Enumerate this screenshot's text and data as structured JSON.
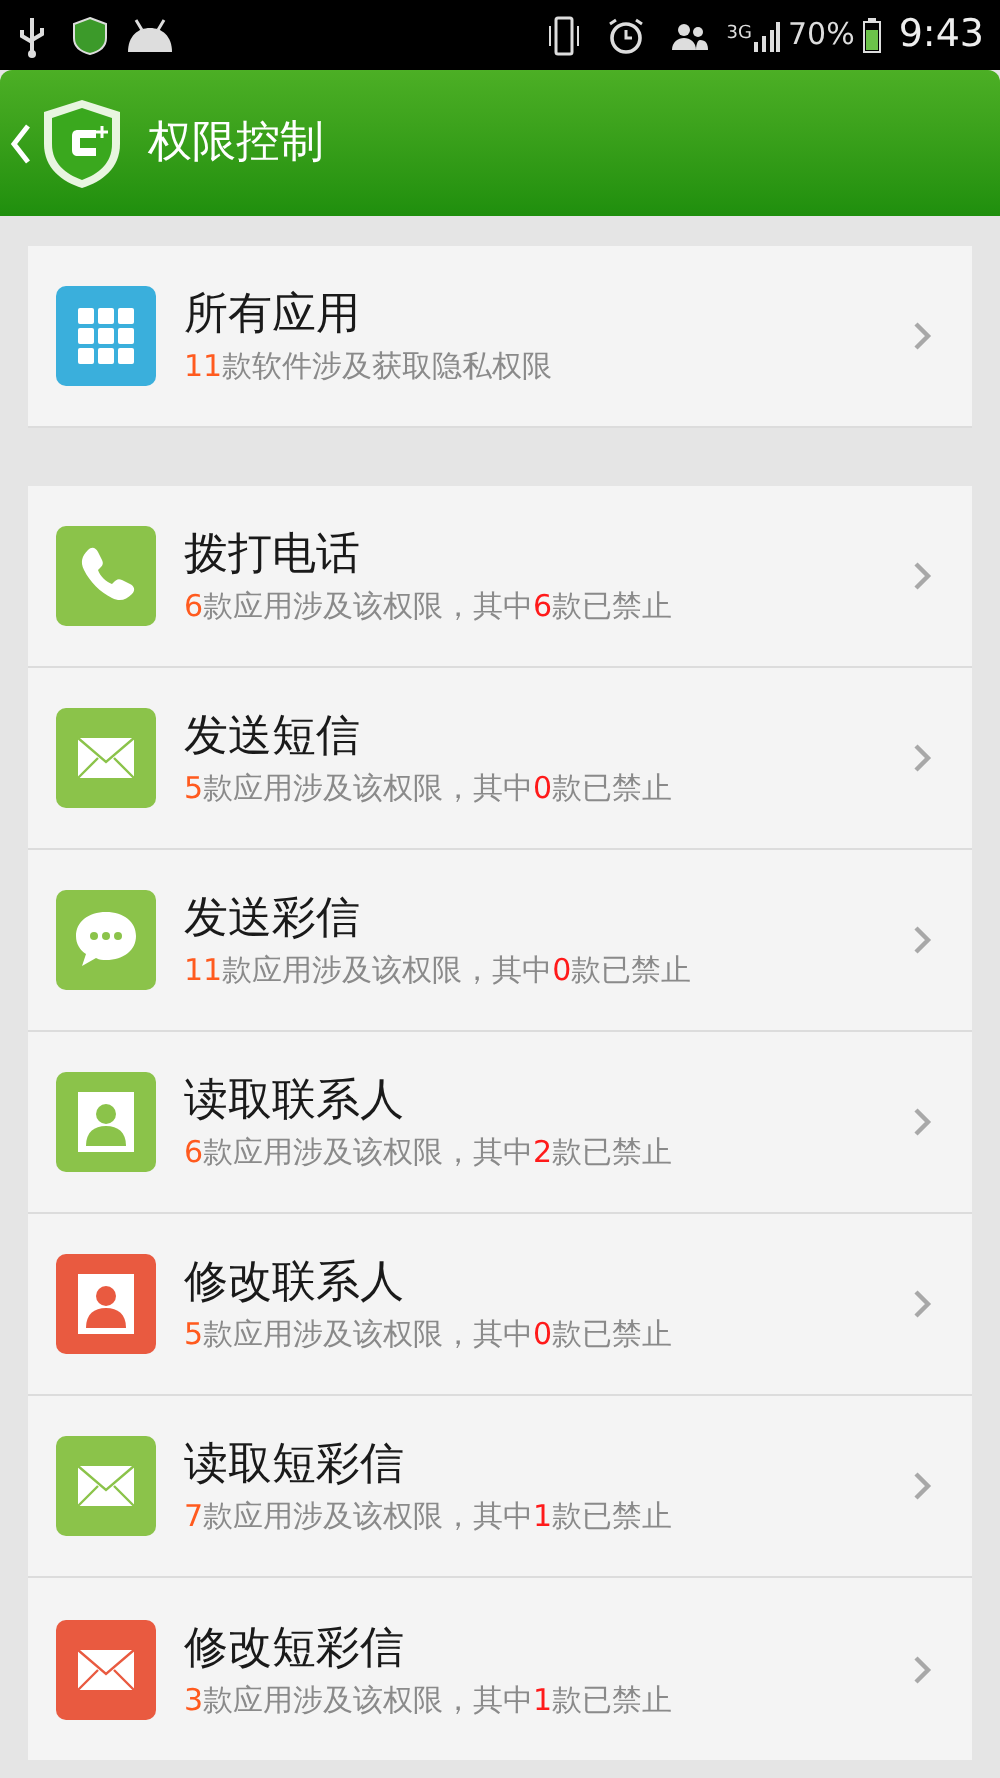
{
  "status_bar": {
    "network": "3G",
    "battery": "70%",
    "time": "9:43"
  },
  "header": {
    "title": "权限控制"
  },
  "summary": {
    "title": "所有应用",
    "kind": "grid",
    "color": "#3aafdc",
    "subtitle": [
      {
        "text": "11",
        "highlight": true
      },
      {
        "text": "款软件涉及获取隐私权限",
        "highlight": false
      }
    ]
  },
  "permissions": [
    {
      "title": "拨打电话",
      "kind": "phone",
      "color": "#8bc34a",
      "subtitle": [
        {
          "text": "6",
          "highlight": true
        },
        {
          "text": "款应用涉及该权限，其中",
          "highlight": false
        },
        {
          "text": "6",
          "highlight": true
        },
        {
          "text": "款已禁止",
          "highlight": false
        }
      ]
    },
    {
      "title": "发送短信",
      "kind": "mail",
      "color": "#8bc34a",
      "subtitle": [
        {
          "text": "5",
          "highlight": true
        },
        {
          "text": "款应用涉及该权限，其中",
          "highlight": false
        },
        {
          "text": "0",
          "highlight": true
        },
        {
          "text": "款已禁止",
          "highlight": false
        }
      ]
    },
    {
      "title": "发送彩信",
      "kind": "chat",
      "color": "#8bc34a",
      "subtitle": [
        {
          "text": "11",
          "highlight": true
        },
        {
          "text": "款应用涉及该权限，其中",
          "highlight": false
        },
        {
          "text": "0",
          "highlight": true
        },
        {
          "text": "款已禁止",
          "highlight": false
        }
      ]
    },
    {
      "title": "读取联系人",
      "kind": "person",
      "color": "#8bc34a",
      "subtitle": [
        {
          "text": "6",
          "highlight": true
        },
        {
          "text": "款应用涉及该权限，其中",
          "highlight": false
        },
        {
          "text": "2",
          "highlight": true
        },
        {
          "text": "款已禁止",
          "highlight": false
        }
      ]
    },
    {
      "title": "修改联系人",
      "kind": "person",
      "color": "#e95a40",
      "subtitle": [
        {
          "text": "5",
          "highlight": true
        },
        {
          "text": "款应用涉及该权限，其中",
          "highlight": false
        },
        {
          "text": "0",
          "highlight": true
        },
        {
          "text": "款已禁止",
          "highlight": false
        }
      ]
    },
    {
      "title": "读取短彩信",
      "kind": "mail",
      "color": "#8bc34a",
      "subtitle": [
        {
          "text": "7",
          "highlight": true
        },
        {
          "text": "款应用涉及该权限，其中",
          "highlight": false
        },
        {
          "text": "1",
          "highlight": true
        },
        {
          "text": "款已禁止",
          "highlight": false
        }
      ]
    },
    {
      "title": "修改短彩信",
      "kind": "mail",
      "color": "#e95a40",
      "subtitle": [
        {
          "text": "3",
          "highlight": true
        },
        {
          "text": "款应用涉及该权限，其中",
          "highlight": false
        },
        {
          "text": "1",
          "highlight": true
        },
        {
          "text": "款已禁止",
          "highlight": false
        }
      ]
    }
  ]
}
